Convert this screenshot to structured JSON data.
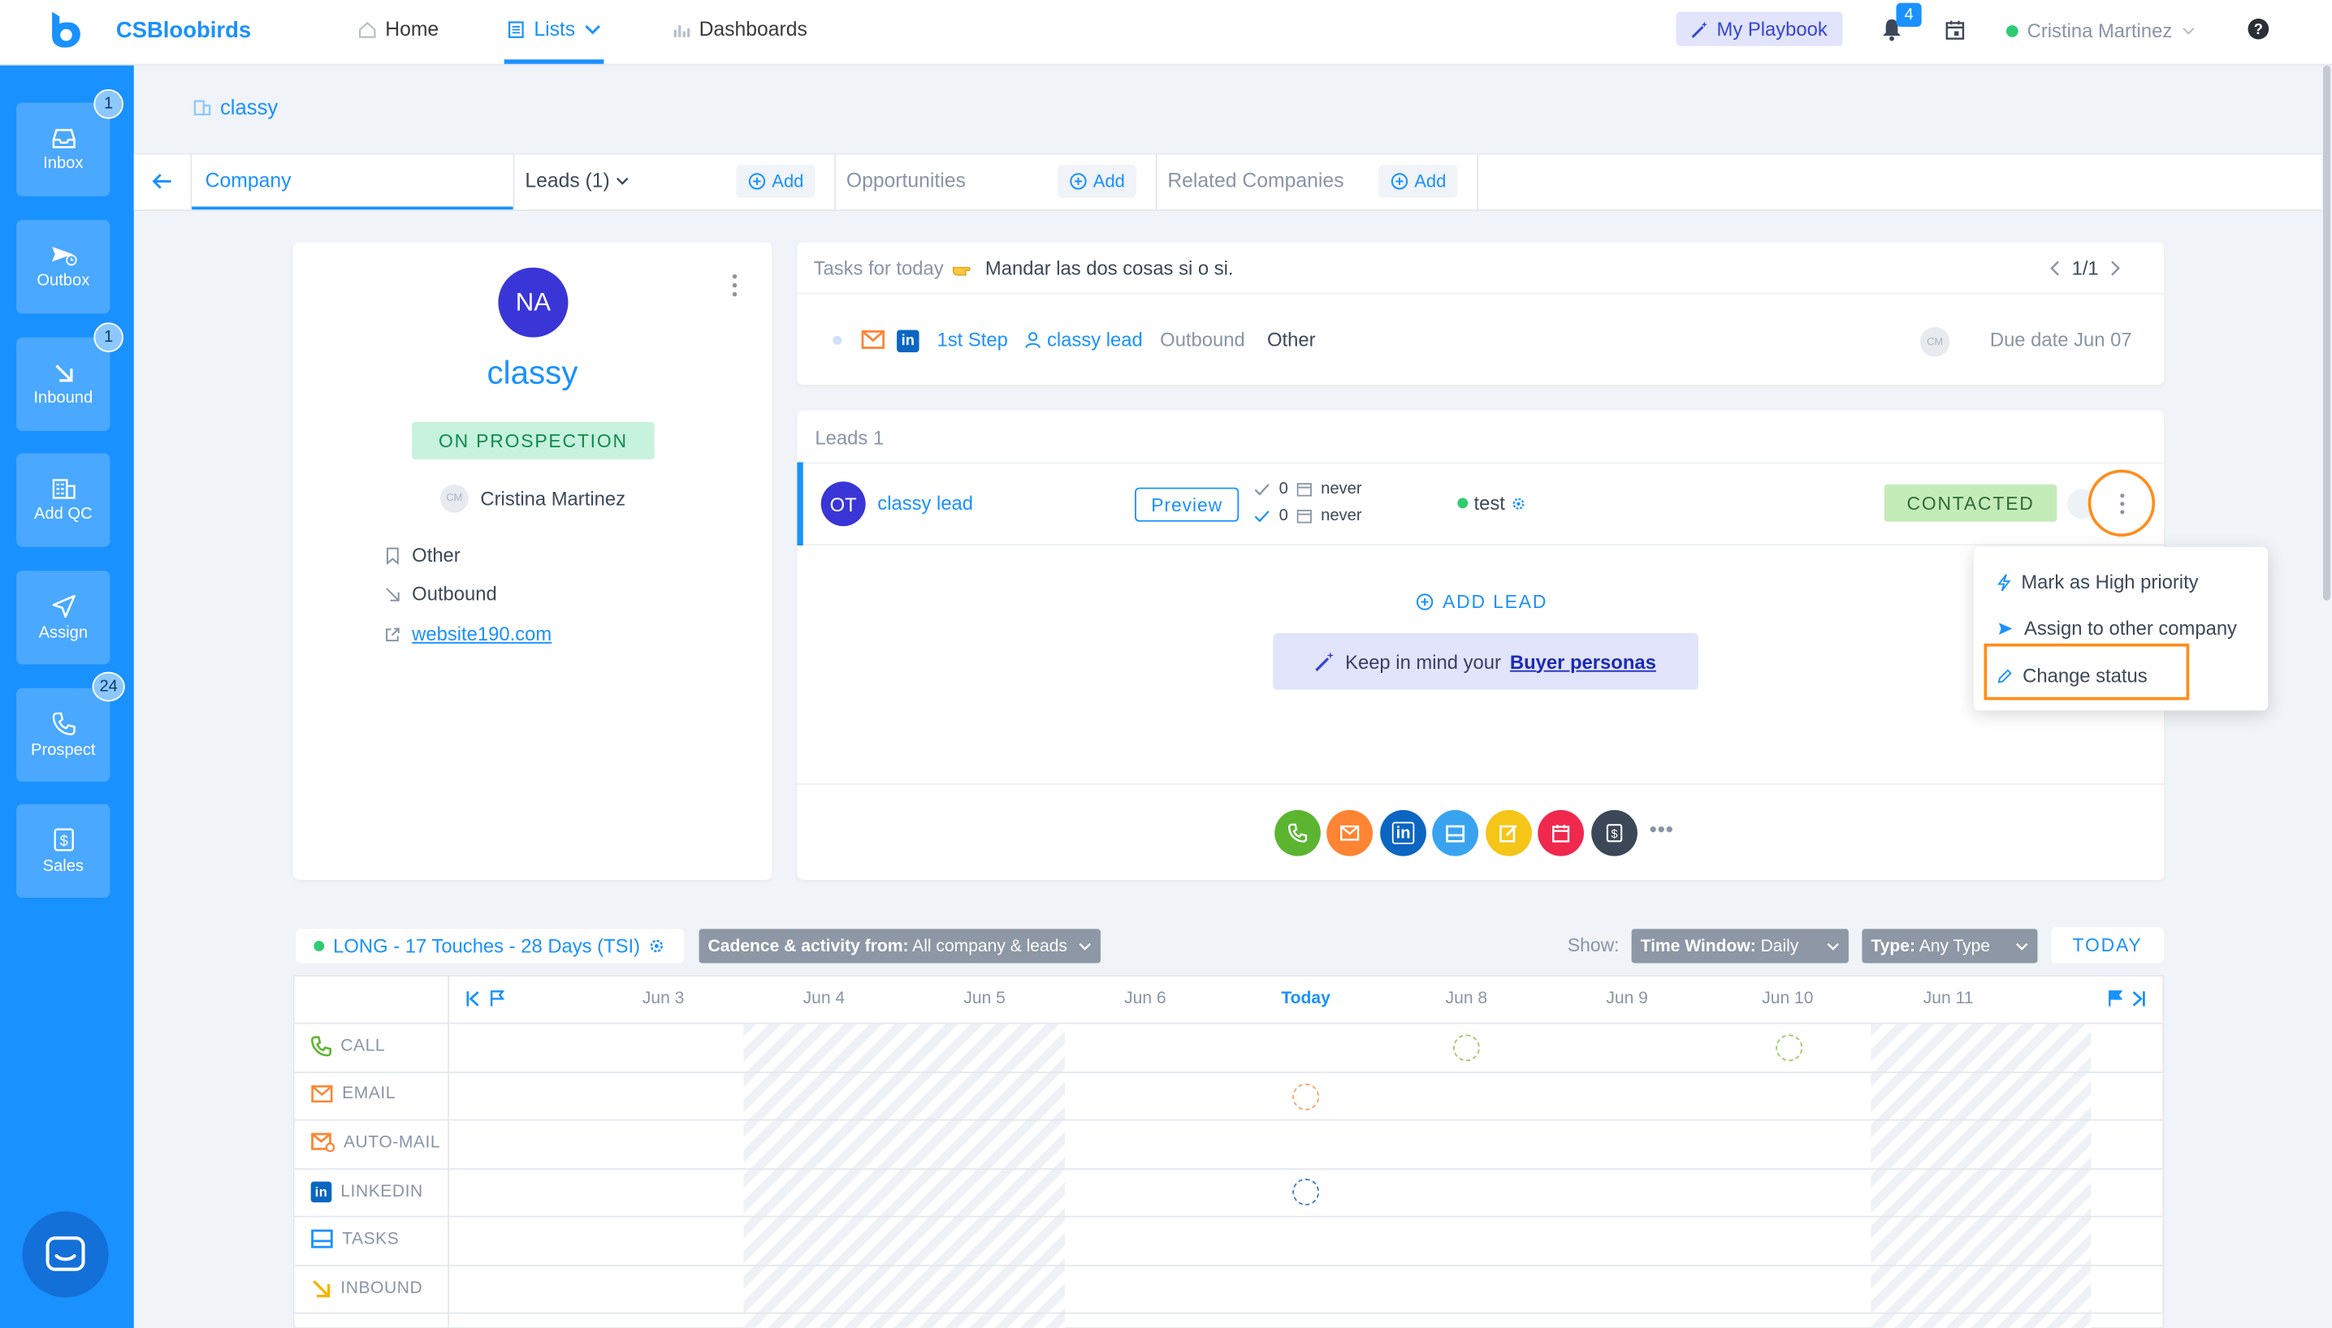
{
  "app": {
    "brand": "CSBloobirds"
  },
  "nav": {
    "home": "Home",
    "lists": "Lists",
    "dashboards": "Dashboards",
    "playbook": "My Playbook",
    "notifications_count": "4",
    "user_name": "Cristina Martinez"
  },
  "sidebar": {
    "items": [
      {
        "label": "Inbox",
        "badge": "1"
      },
      {
        "label": "Outbox",
        "badge": ""
      },
      {
        "label": "Inbound",
        "badge": "1"
      },
      {
        "label": "Add QC",
        "badge": ""
      },
      {
        "label": "Assign",
        "badge": ""
      },
      {
        "label": "Prospect",
        "badge": "24"
      },
      {
        "label": "Sales",
        "badge": ""
      }
    ]
  },
  "breadcrumb": {
    "name": "classy"
  },
  "tabs": {
    "company": "Company",
    "leads": "Leads (1)",
    "opportunities": "Opportunities",
    "related": "Related Companies",
    "add": "Add"
  },
  "company": {
    "initials": "NA",
    "name": "classy",
    "status": "ON PROSPECTION",
    "owner_initials": "CM",
    "owner": "Cristina Martinez",
    "source": "Other",
    "type": "Outbound",
    "website": "website190.com"
  },
  "tasks": {
    "header_label": "Tasks for today",
    "header_text": "Mandar las dos cosas si o si.",
    "pager": "1/1",
    "step": "1st Step",
    "lead": "classy lead",
    "type": "Outbound",
    "source": "Other",
    "assignee_initials": "CM",
    "due": "Due date Jun 07"
  },
  "leads": {
    "title": "Leads 1",
    "lead_initials": "OT",
    "lead_name": "classy lead",
    "preview": "Preview",
    "count_1": "0",
    "date_1": "never",
    "count_2": "0",
    "date_2": "never",
    "tag": "test",
    "status": "CONTACTED",
    "add_lead": "ADD LEAD",
    "buyer_prefix": "Keep in mind your",
    "buyer_link": "Buyer personas"
  },
  "menu": {
    "item_1": "Mark as High priority",
    "item_2": "Assign to other company",
    "item_3": "Change status"
  },
  "cadence": {
    "name": "LONG - 17 Touches - 28 Days (TSI)",
    "activity_label": "Cadence & activity from:",
    "activity_value": "All company & leads",
    "show": "Show:",
    "window_label": "Time Window:",
    "window_value": "Daily",
    "type_label": "Type:",
    "type_value": "Any Type",
    "today": "TODAY",
    "days": [
      "Jun 3",
      "Jun 4",
      "Jun 5",
      "Jun 6",
      "Today",
      "Jun 8",
      "Jun 9",
      "Jun 10",
      "Jun 11"
    ],
    "rows": [
      "CALL",
      "EMAIL",
      "AUTO-MAIL",
      "LINKEDIN",
      "TASKS",
      "INBOUND"
    ]
  },
  "colors": {
    "brand": "#1991ff",
    "sidebar": "#1991ff",
    "highlight": "#ff8c1a",
    "status_prospection": "#c7f2dd",
    "status_contacted": "#c4ecb9"
  }
}
